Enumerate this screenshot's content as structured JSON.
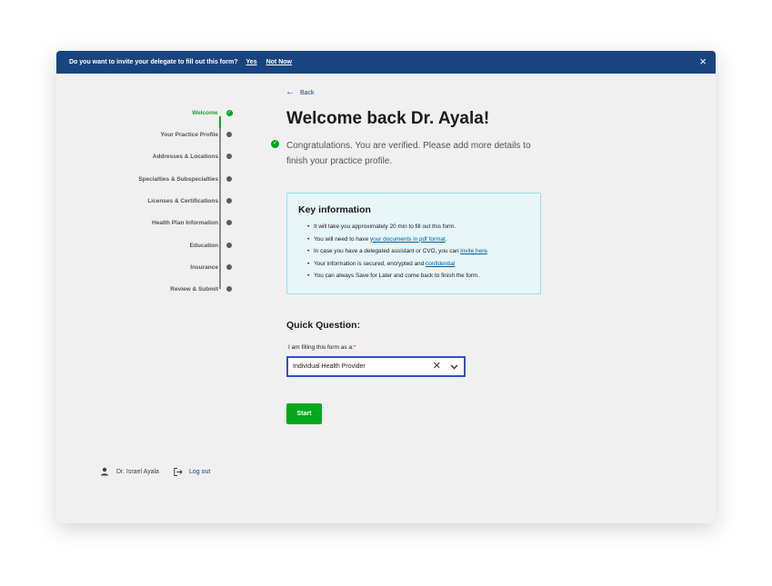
{
  "banner": {
    "question": "Do you want to invite your delegate to fill out this form?",
    "yes": "Yes",
    "not_now": "Not Now",
    "close": "×"
  },
  "stepper": {
    "items": [
      {
        "label": "Welcome",
        "active": true
      },
      {
        "label": "Your Practice Profile",
        "active": false
      },
      {
        "label": "Addresses & Locations",
        "active": false
      },
      {
        "label": "Specialties & Subspecialties",
        "active": false
      },
      {
        "label": "Licenses & Certifications",
        "active": false
      },
      {
        "label": "Health Plan Information",
        "active": false
      },
      {
        "label": "Education",
        "active": false
      },
      {
        "label": "Insurance",
        "active": false
      },
      {
        "label": "Review & Submit",
        "active": false
      }
    ]
  },
  "user": {
    "name": "Dr. Israel Ayala",
    "logout": "Log out"
  },
  "main": {
    "back": "Back",
    "title": "Welcome back Dr. Ayala!",
    "verified_text": "Congratulations. You are verified. Please add more details to finish  your practice profile.",
    "key_info": {
      "heading": "Key information",
      "line1": "It will take you approximately 20 min to fill out this form.",
      "line2_pre": "You will need to have ",
      "line2_link": "your documents in pdf format",
      "line2_post": ".",
      "line3_pre": "In case you have a delegated assistant or CVO,  you can ",
      "line3_link": "invite here",
      "line3_post": ".",
      "line4_pre": "Your information is secured, encrypted and ",
      "line4_link": "confidential",
      "line5": "You can always Save for Later and come back to finish the form."
    },
    "quick_question": "Quick Question:",
    "field_label": "I am filling this form as a:",
    "required_mark": "*",
    "select_value": "Individual Health Provider",
    "start": "Start"
  },
  "colors": {
    "banner": "#1a4480",
    "accent_green": "#00a91c",
    "link": "#005ea2",
    "info_bg": "#e7f6f8",
    "select_border": "#2f50c4"
  }
}
